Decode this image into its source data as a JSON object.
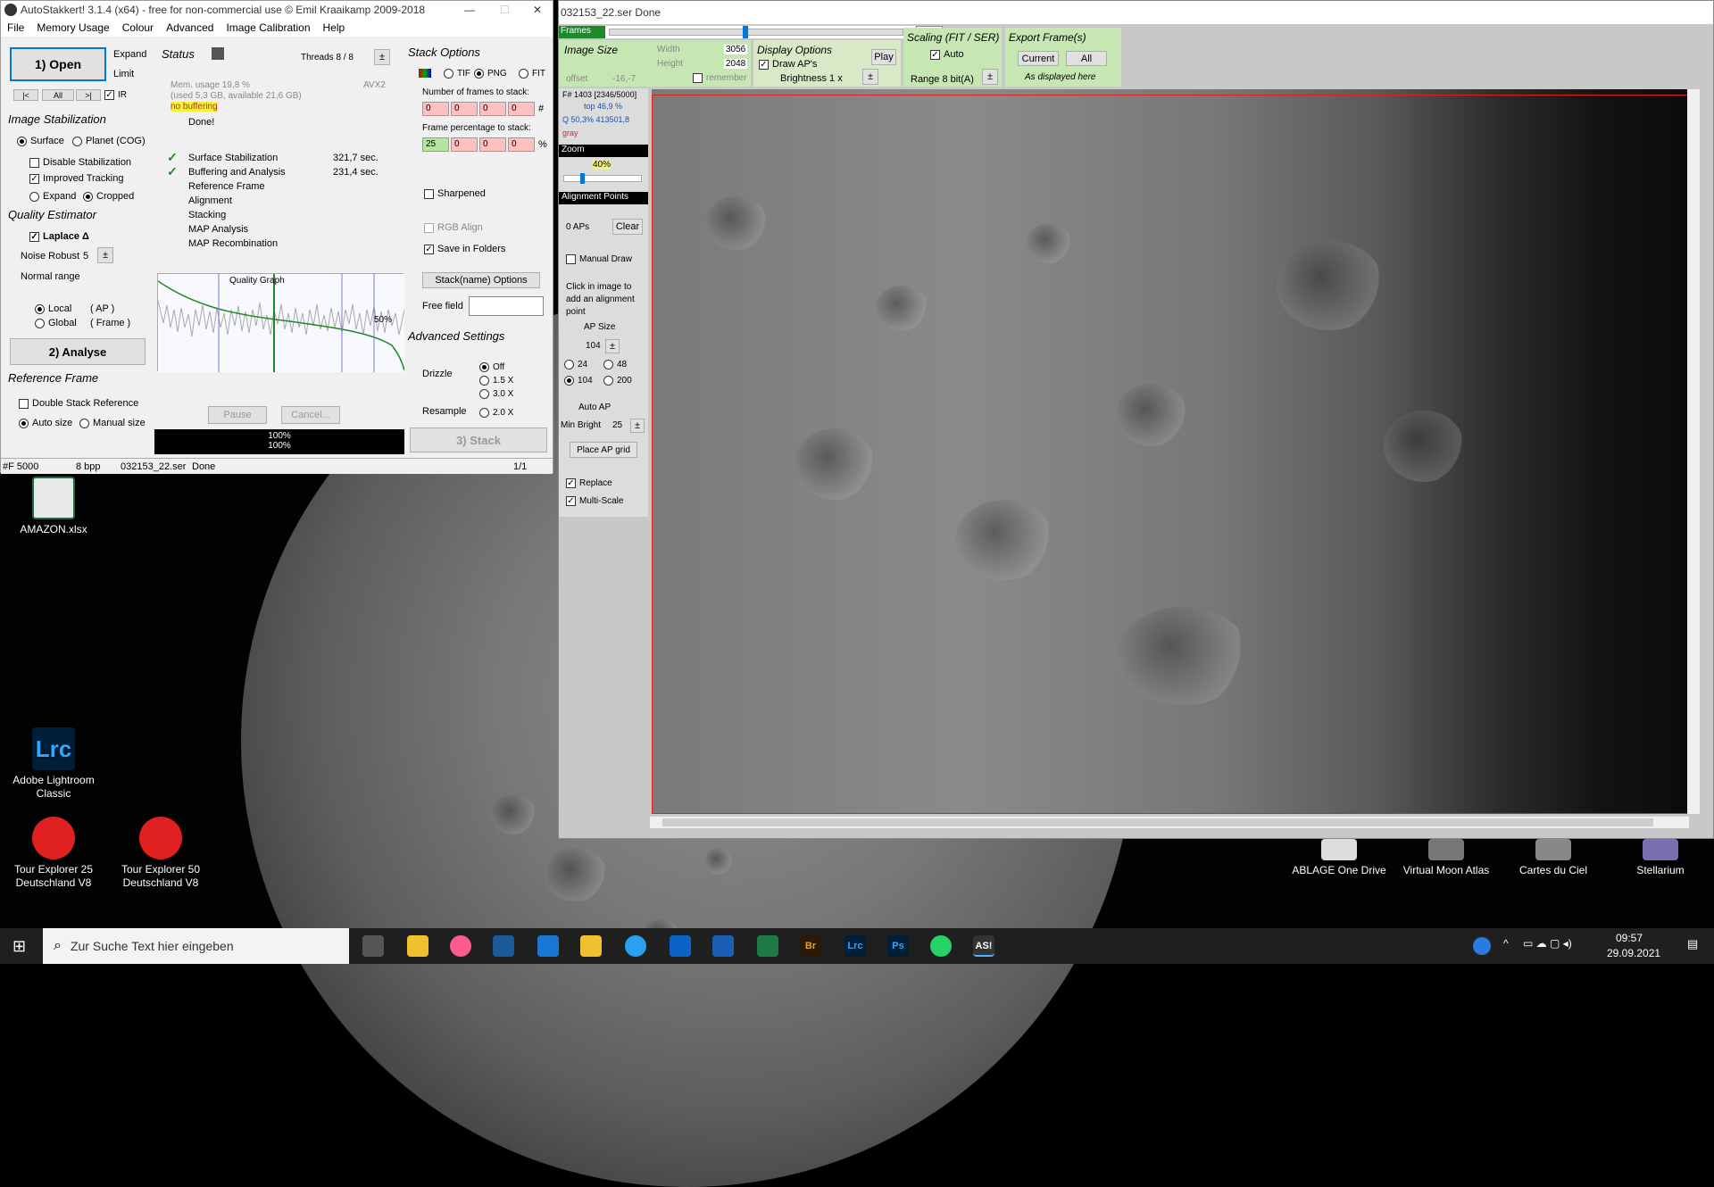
{
  "as_window": {
    "title": "AutoStakkert! 3.1.4 (x64) - free for non-commercial use © Emil Kraaikamp 2009-2018",
    "menu": [
      "File",
      "Memory Usage",
      "Colour",
      "Advanced",
      "Image Calibration",
      "Help"
    ],
    "open_label": "1) Open",
    "expand_label": "Expand",
    "limit_label": "Limit",
    "nav": [
      "|<",
      "All",
      ">|"
    ],
    "ir_label": "IR",
    "image_stabilization": "Image Stabilization",
    "surface": "Surface",
    "planet": "Planet (COG)",
    "disable_stab": "Disable Stabilization",
    "improved_tracking": "Improved Tracking",
    "expand": "Expand",
    "cropped": "Cropped",
    "quality_estimator": "Quality Estimator",
    "laplace": "Laplace Δ",
    "noise_robust": "Noise Robust",
    "noise_robust_value": "5",
    "normal_range": "Normal range",
    "local": "Local",
    "local_ap": "( AP )",
    "global": "Global",
    "global_frame": "( Frame )",
    "analyse_label": "2) Analyse",
    "reference_frame": "Reference Frame",
    "double_stack": "Double Stack Reference",
    "auto_size": "Auto size",
    "manual_size": "Manual size",
    "status_label": "Status",
    "threads": "Threads 8 / 8",
    "mem_usage": "Mem. usage 19,8 %",
    "mem_detail": "(used 5,3 GB, available 21,6 GB)",
    "avx": "AVX2",
    "no_buffering": "no buffering",
    "done": "Done!",
    "steps": [
      {
        "name": "Surface Stabilization",
        "time": "321,7 sec."
      },
      {
        "name": "Buffering and Analysis",
        "time": "231,4 sec."
      },
      {
        "name": "Reference Frame",
        "time": ""
      },
      {
        "name": "Alignment",
        "time": ""
      },
      {
        "name": "Stacking",
        "time": ""
      },
      {
        "name": "MAP Analysis",
        "time": ""
      },
      {
        "name": "MAP Recombination",
        "time": ""
      }
    ],
    "quality_graph": "Quality Graph",
    "graph_pct": "50%",
    "pause": "Pause",
    "cancel": "Cancel...",
    "progress1": "100%",
    "progress2": "100%",
    "stack_options": "Stack Options",
    "tif": "TIF",
    "png": "PNG",
    "fit": "FIT",
    "num_frames_label": "Number of frames to stack:",
    "num_frames": [
      "0",
      "0",
      "0",
      "0"
    ],
    "hash": "#",
    "frame_pct_label": "Frame percentage to stack:",
    "frame_pct": [
      "25",
      "0",
      "0",
      "0"
    ],
    "pct": "%",
    "sharpened": "Sharpened",
    "rgb_align": "RGB Align",
    "save_folders": "Save in Folders",
    "stackname_options": "Stack(name) Options",
    "free_field": "Free field",
    "advanced_settings": "Advanced Settings",
    "drizzle": "Drizzle",
    "drizzle_opts": [
      "Off",
      "1.5 X",
      "3.0 X"
    ],
    "resample": "Resample",
    "resample_opt": "2.0 X",
    "stack_button": "3) Stack",
    "statusbar": {
      "frames": "#F 5000",
      "bpp": "8 bpp",
      "file": "032153_22.ser",
      "state": "Done",
      "page": "1/1"
    }
  },
  "image_window": {
    "title": "032153_22.ser   Done",
    "frames_label": "Frames",
    "frame_count": "2346",
    "slider_position": 0.46,
    "image_size": "Image Size",
    "width_label": "Width",
    "width_value": "3056",
    "height_label": "Height",
    "height_value": "2048",
    "offset": "offset",
    "offset_value": "-16,-7",
    "remember": "remember",
    "display_options": "Display Options",
    "draw_aps": "Draw AP's",
    "brightness": "Brightness 1 x",
    "play": "Play",
    "scaling": "Scaling (FIT / SER)",
    "auto": "Auto",
    "range": "Range 8 bit(A)",
    "export": "Export Frame(s)",
    "current": "Current",
    "all": "All",
    "as_displayed": "As displayed here",
    "frame_info": "F# 1403 [2346/5000]",
    "top_info": "top 46,9 %",
    "q_info": "Q 50,3%  413501,8",
    "gray": "gray",
    "zoom_label": "Zoom",
    "zoom_value": "40%",
    "ap_header": "Alignment Points",
    "ap_count": "0 APs",
    "clear": "Clear",
    "manual_draw": "Manual Draw",
    "click_hint": "Click in image to add an alignment point",
    "ap_size": "AP Size",
    "ap_size_value": "104",
    "ap_opts": [
      "24",
      "48",
      "104",
      "200"
    ],
    "auto_ap": "Auto AP",
    "min_bright": "Min Bright",
    "min_bright_value": "25",
    "place_grid": "Place AP grid",
    "replace": "Replace",
    "multi_scale": "Multi-Scale"
  },
  "desktop_icons": [
    {
      "label": "AMAZON.xlsx"
    },
    {
      "label": "Adobe Lightroom Classic"
    },
    {
      "label": "Tour Explorer 25 Deutschland V8"
    },
    {
      "label": "Tour Explorer 50 Deutschland V8"
    },
    {
      "label": "ABLAGE One Drive"
    },
    {
      "label": "Virtual Moon Atlas"
    },
    {
      "label": "Cartes du Ciel"
    },
    {
      "label": "Stellarium"
    }
  ],
  "taskbar": {
    "search_placeholder": "Zur Suche Text hier eingeben",
    "time": "09:57",
    "date": "29.09.2021"
  },
  "colors": {
    "green_panel": "#c6e6b4",
    "accent": "#0078d7",
    "red_frame": "#e02020"
  }
}
